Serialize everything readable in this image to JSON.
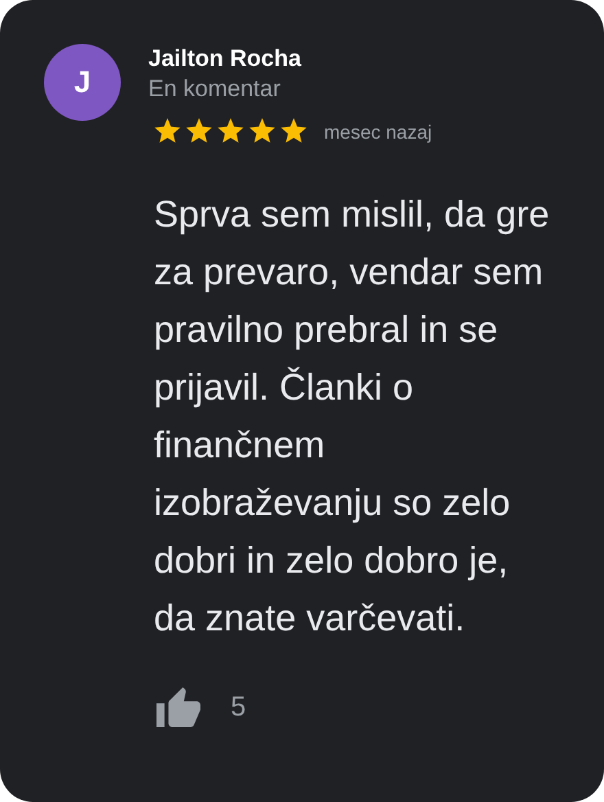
{
  "review": {
    "avatar_letter": "J",
    "author": "Jailton Rocha",
    "subtitle": "En komentar",
    "stars": 5,
    "time": "mesec nazaj",
    "text": "Sprva sem mislil, da gre za prevaro, vendar sem pravilno prebral in se prijavil. Članki o finančnem izobraževanju so zelo dobri in zelo dobro je, da znate varčevati.",
    "likes": "5"
  }
}
